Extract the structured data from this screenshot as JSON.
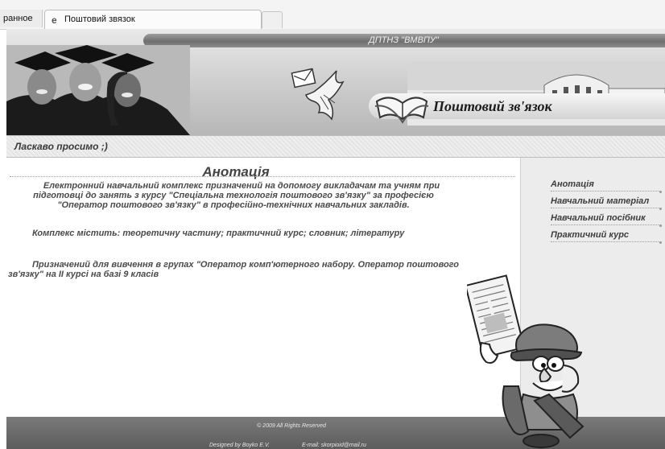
{
  "browser": {
    "tab_favorites_label": "ранное",
    "tab_title": "Поштовий звязок"
  },
  "header": {
    "institution": "ДПТНЗ \"ВМВПУ\"",
    "site_title": "Поштовий зв'язок"
  },
  "welcome": "Ласкаво просимо    ;)",
  "main": {
    "title": "Анотація",
    "paragraphs": [
      "Електронний навчальний комплекс призначений на допомогу викладачам та учням при підготовці до занять з курсу \"Спеціальна технологія поштового зв'язку\" за професією \"Оператор поштового зв'язку\" в професійно-технічних навчальних закладів.",
      "Комплекс містить: теоретичну частину; практичний курс; словник; літературу",
      "Призначений для вивчення в групах \"Оператор комп'ютерного набору. Оператор поштового зв'язку\" на ІІ курсі на базі 9 класів"
    ]
  },
  "sidebar": {
    "items": [
      {
        "label": "Анотація"
      },
      {
        "label": "Навчальний матеріал"
      },
      {
        "label": "Навчальний посібник"
      },
      {
        "label": "Практичний курс"
      }
    ]
  },
  "footer": {
    "copyright": "© 2009 All Rights Reserved",
    "designed_by": "Designed by Boyko E.V.",
    "email": "E-mail: skorpioid@mail.ru"
  },
  "icons": [
    "ie-icon",
    "graduates-photo",
    "dove-letter-icon",
    "college-building-photo",
    "open-book-icon",
    "postman-mascot"
  ]
}
